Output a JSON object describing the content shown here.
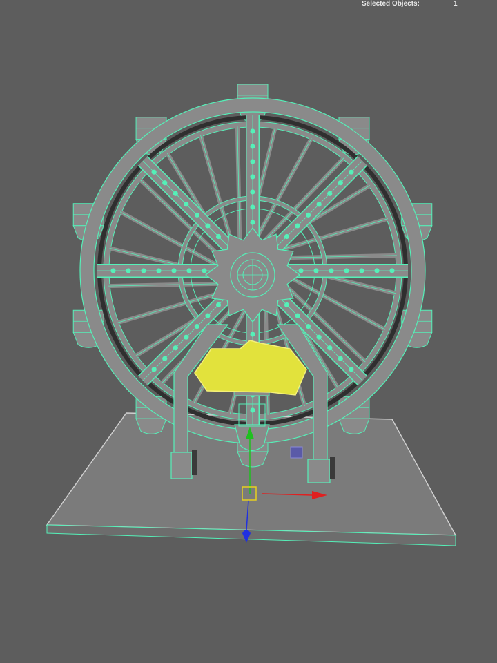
{
  "hud": {
    "selected_objects_label": "Selected Objects:",
    "selected_objects_count": "1"
  },
  "viewport": {
    "background_color": "#5d5d5d",
    "wireframe_color": "#55f0b8",
    "mesh_color": "#8a8a8a",
    "selected_face_color": "#e2e23c",
    "manipulator": {
      "x_axis_color": "#e02020",
      "y_axis_color": "#20c020",
      "z_axis_color": "#2030e0",
      "center_color": "#e8d020"
    }
  }
}
